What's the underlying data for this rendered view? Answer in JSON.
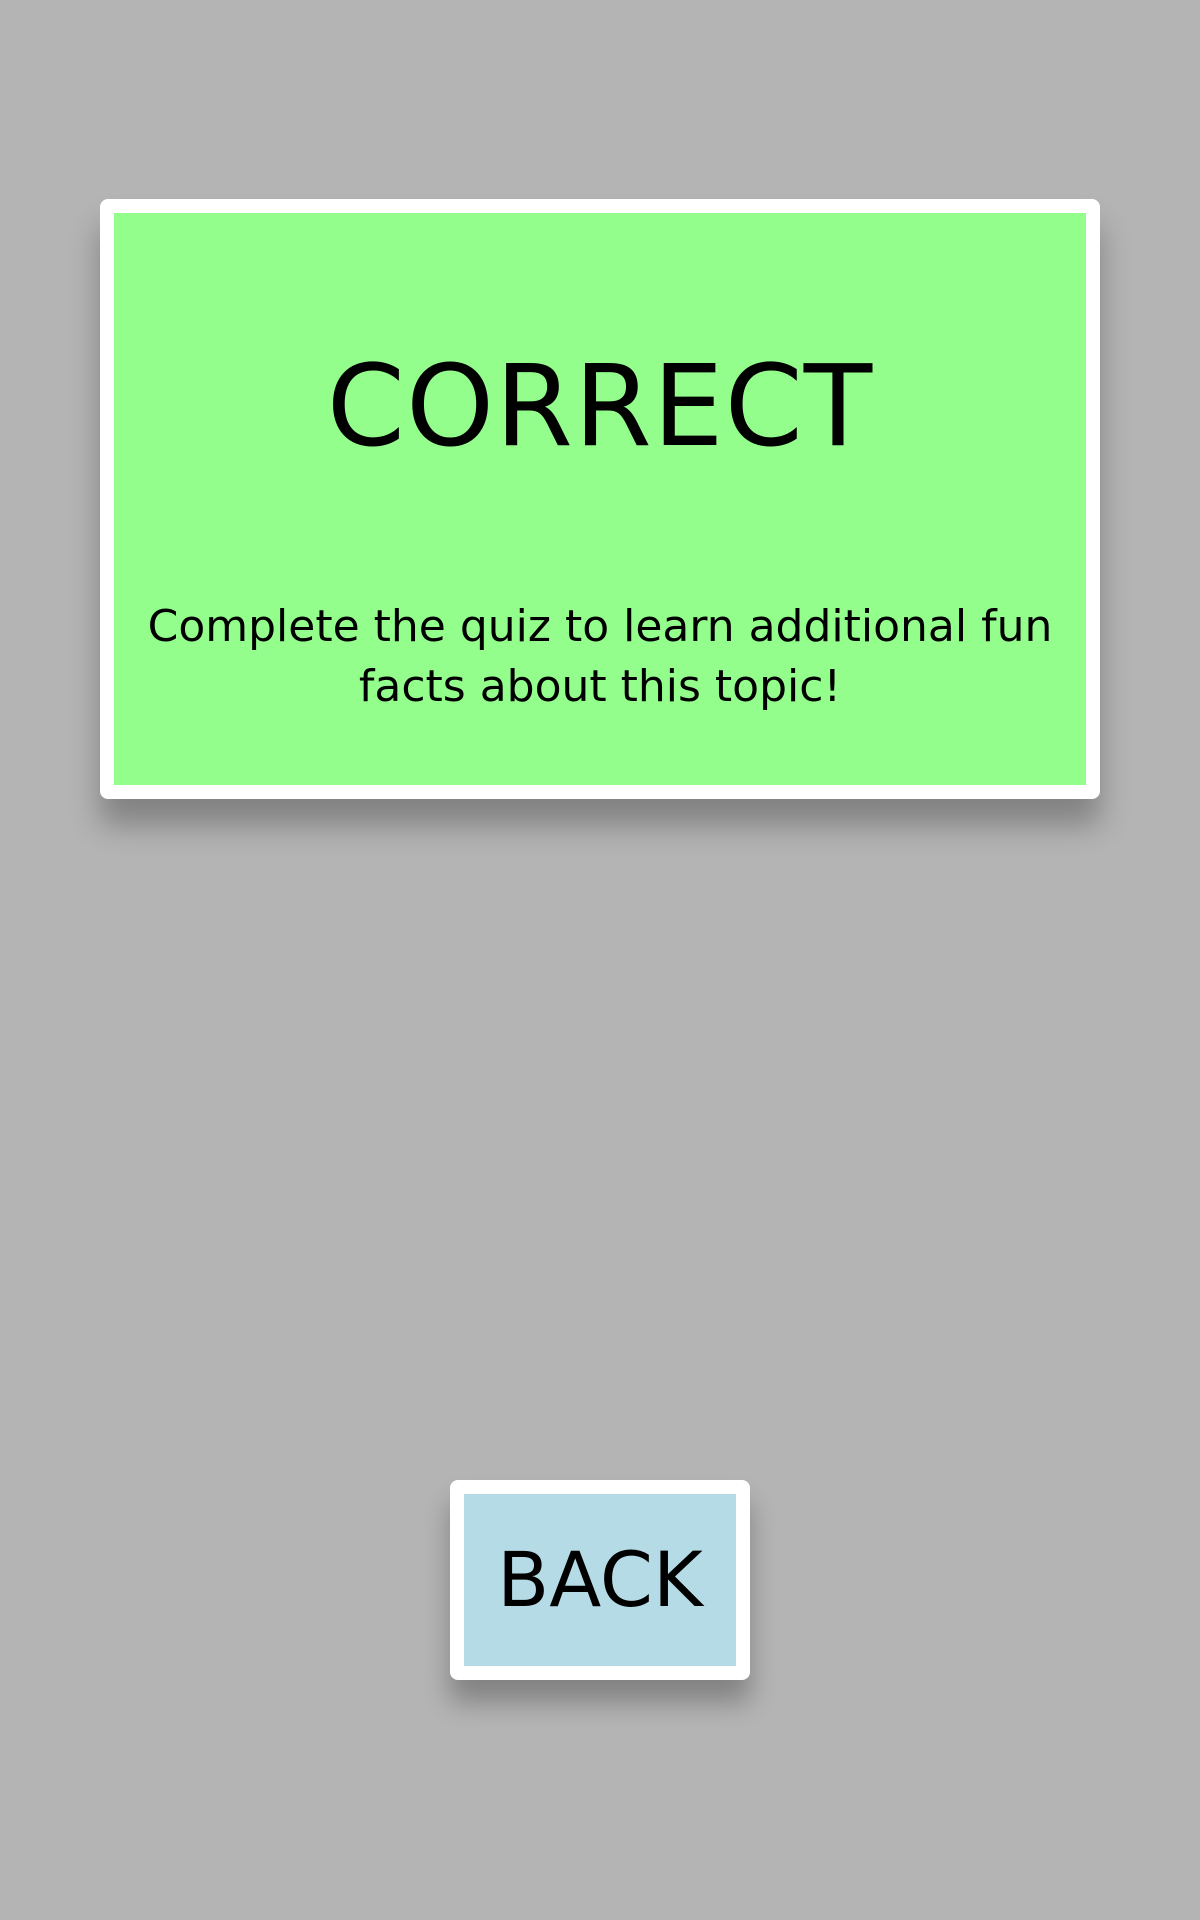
{
  "result": {
    "title": "CORRECT",
    "message": "Complete the quiz to learn additional fun facts about this topic!",
    "card_color": "#94fe8d"
  },
  "back_button": {
    "label": "BACK",
    "color": "#b5dbe6"
  },
  "background_color": "#b4b4b4"
}
